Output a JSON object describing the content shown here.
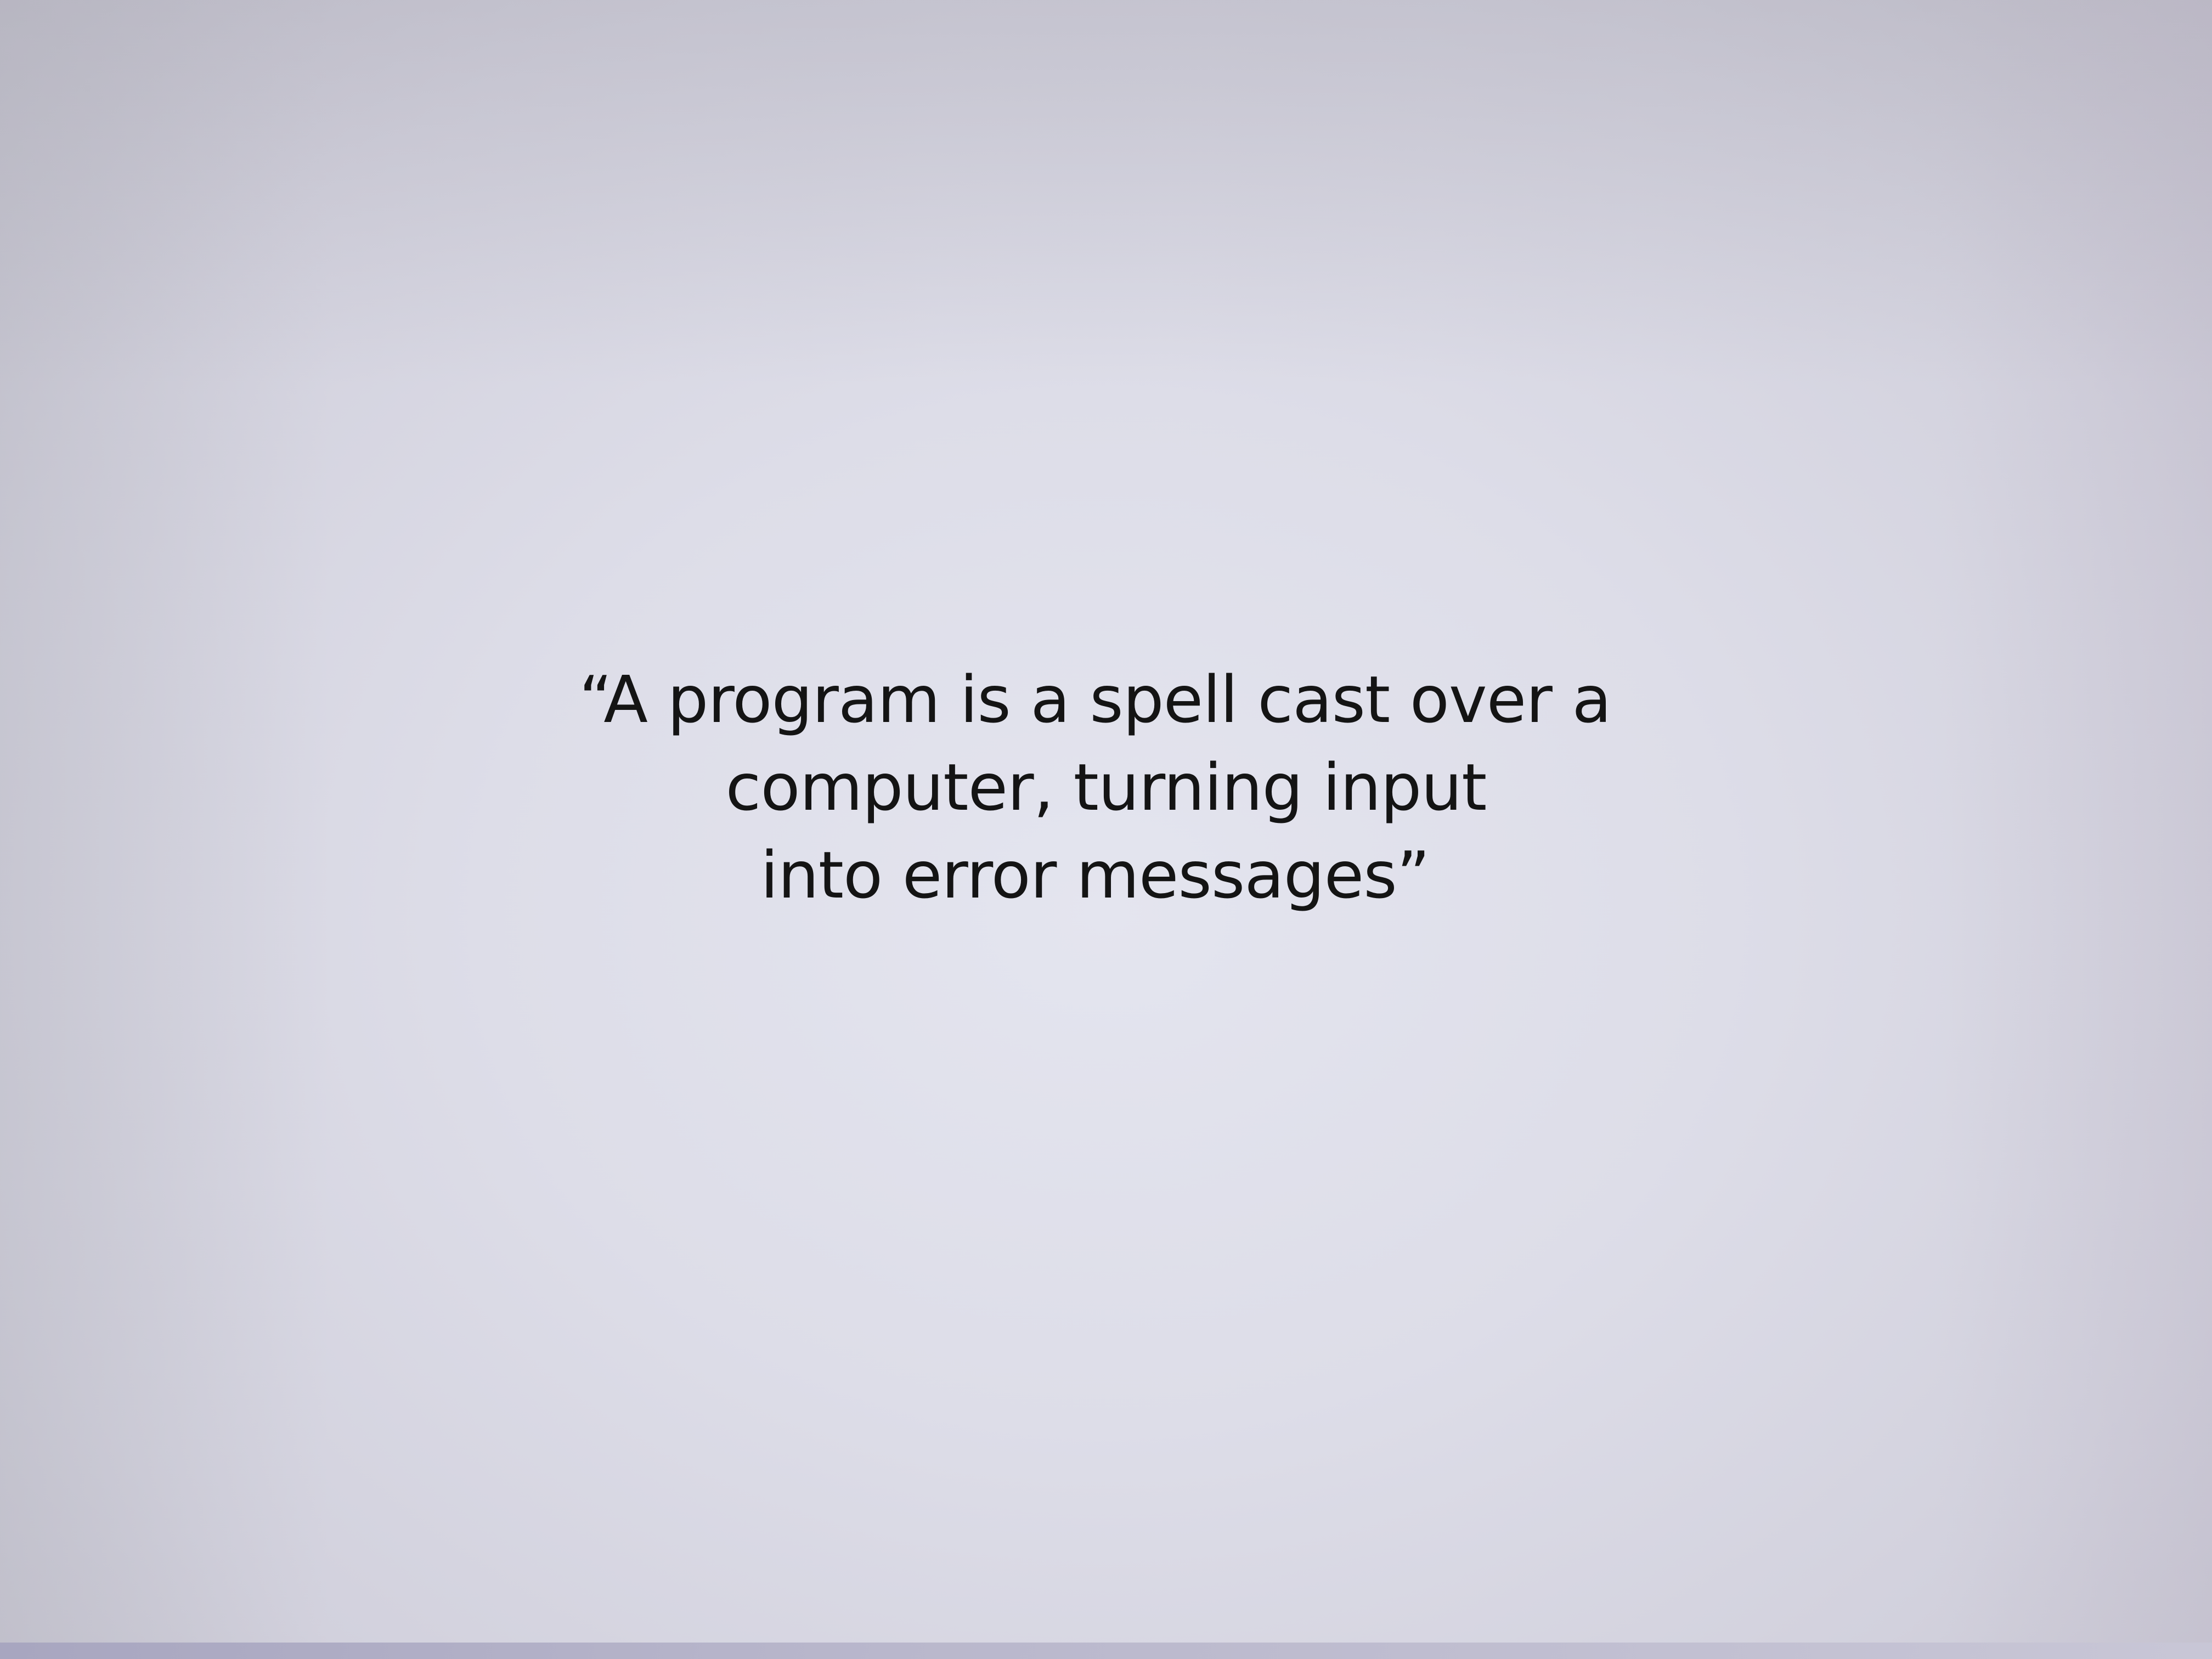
{
  "slide": {
    "quote_lines": [
      "“A program is a spell cast over a",
      "computer, turning input",
      "into error messages”"
    ]
  }
}
